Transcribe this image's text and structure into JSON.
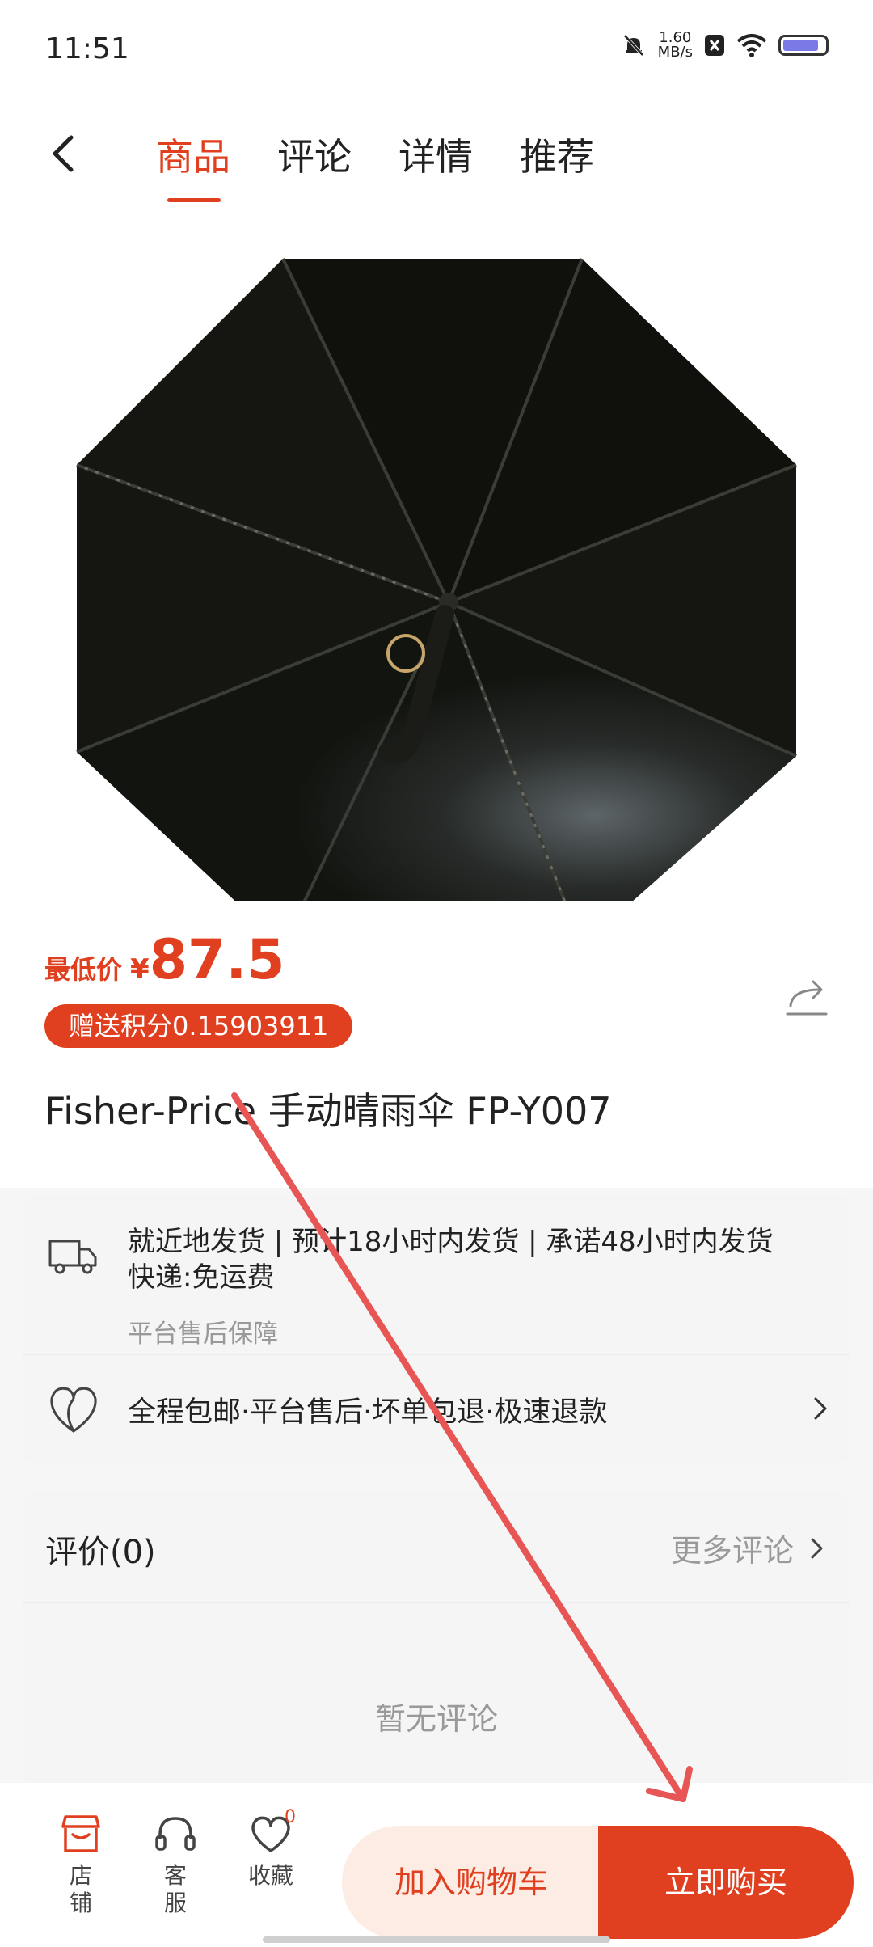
{
  "status_bar": {
    "time": "11:51",
    "net_speed_value": "1.60",
    "net_speed_unit": "MB/s"
  },
  "tabs": [
    {
      "label": "商品",
      "active": true
    },
    {
      "label": "评论",
      "active": false
    },
    {
      "label": "详情",
      "active": false
    },
    {
      "label": "推荐",
      "active": false
    }
  ],
  "product": {
    "price_label": "最低价",
    "currency": "¥",
    "price": "87.5",
    "points_badge": "赠送积分0.15903911",
    "title": "Fisher-Price 手动晴雨伞 FP-Y007"
  },
  "shipping": {
    "text": "就近地发货 | 预计18小时内发货 | 承诺48小时内发货　 快递:免运费",
    "sub": "平台售后保障",
    "guarantee": "全程包邮·平台售后·坏单包退·极速退款"
  },
  "reviews": {
    "title": "评价(0)",
    "more": "更多评论",
    "empty": "暂无评论"
  },
  "bottom_bar": {
    "store": "店\n铺",
    "service": "客\n服",
    "favorite": "收藏",
    "favorite_count": "0",
    "add_to_cart": "加入购物车",
    "buy_now": "立即购买"
  },
  "colors": {
    "accent": "#e0401f",
    "cart_bg": "#fdece4",
    "arrow": "#e85555"
  },
  "icons": [
    "back-icon",
    "share-icon",
    "truck-icon",
    "heart-icon",
    "chevron-right-icon",
    "store-icon",
    "headset-icon",
    "favorite-heart-icon",
    "mute-bell-icon",
    "wifi-icon",
    "battery-icon"
  ]
}
